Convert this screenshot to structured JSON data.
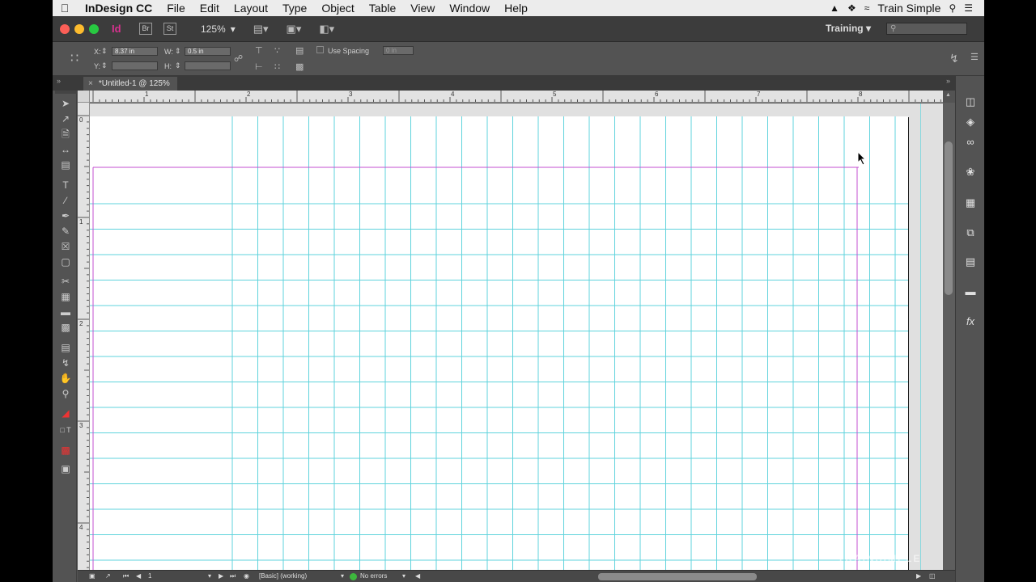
{
  "menubar": {
    "app_name": "InDesign CC",
    "items": [
      "File",
      "Edit",
      "Layout",
      "Type",
      "Object",
      "Table",
      "View",
      "Window",
      "Help"
    ],
    "user": "Train Simple"
  },
  "appbar": {
    "logo": "Id",
    "bridge": "Br",
    "stock": "St",
    "zoom": "125%",
    "workspace": "Training"
  },
  "control": {
    "x_label": "X:",
    "x_value": "8.37 in",
    "y_label": "Y:",
    "y_value": "",
    "w_label": "W:",
    "w_value": "0.5 in",
    "h_label": "H:",
    "h_value": "",
    "use_spacing": "Use Spacing",
    "spacing_value": "0 in"
  },
  "document": {
    "tab_title": "*Untitled-1 @ 125%"
  },
  "rulers": {
    "horizontal": [
      "1",
      "2",
      "3",
      "4",
      "5",
      "6",
      "7",
      "8"
    ],
    "vertical": [
      "0",
      "1",
      "2",
      "3",
      "4"
    ]
  },
  "status": {
    "page": "1",
    "profile": "[Basic] (working)",
    "preflight": "No errors"
  },
  "watermark": "TRAINSIMPLE",
  "colors": {
    "grid": "#5fd3dc",
    "margin": "#c34fd0",
    "preflight_ok": "#3db83d",
    "logo": "#d8318f"
  }
}
